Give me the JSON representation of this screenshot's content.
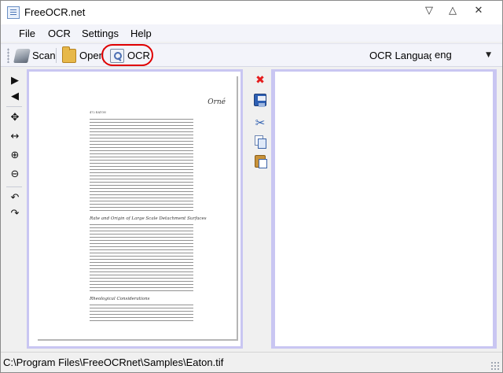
{
  "window": {
    "title": "FreeOCR.net",
    "minimize_glyph": "▽",
    "maximize_glyph": "△",
    "close_glyph": "✕"
  },
  "menu": {
    "items": [
      {
        "label": "File"
      },
      {
        "label": "OCR"
      },
      {
        "label": "Settings"
      },
      {
        "label": "Help"
      }
    ]
  },
  "toolbar": {
    "scan_label": "Scan",
    "open_label": "Open",
    "ocr_label": "OCR",
    "ocr_language_label": "OCR Language",
    "ocr_language_value": "eng",
    "highlight_color": "#e00000"
  },
  "image_tools": [
    {
      "name": "next-page-icon",
      "glyph": "▶"
    },
    {
      "name": "previous-page-icon",
      "glyph": "◀"
    },
    {
      "name": "move-icon",
      "glyph": "✥"
    },
    {
      "name": "fit-width-icon",
      "glyph": "↔"
    },
    {
      "name": "zoom-in-icon",
      "glyph": "⊕"
    },
    {
      "name": "zoom-out-icon",
      "glyph": "⊖"
    },
    {
      "name": "rotate-left-icon",
      "glyph": "↶"
    },
    {
      "name": "rotate-right-icon",
      "glyph": "↷"
    }
  ],
  "text_tools": [
    {
      "name": "clear-icon"
    },
    {
      "name": "save-icon"
    },
    {
      "name": "cut-icon"
    },
    {
      "name": "copy-icon"
    },
    {
      "name": "paste-icon"
    }
  ],
  "document": {
    "signature": "Orné",
    "page_header": "472          EATON",
    "heading_1": "Rate and Origin of Large Scale Detachment Surfaces",
    "heading_2": "Rheological Considerations"
  },
  "status": {
    "path": "C:\\Program Files\\FreeOCRnet\\Samples\\Eaton.tif"
  },
  "colors": {
    "panel_border": "#c9c6f2",
    "clear_icon": "#e51d1d",
    "icon_blue": "#2d5fb3"
  }
}
